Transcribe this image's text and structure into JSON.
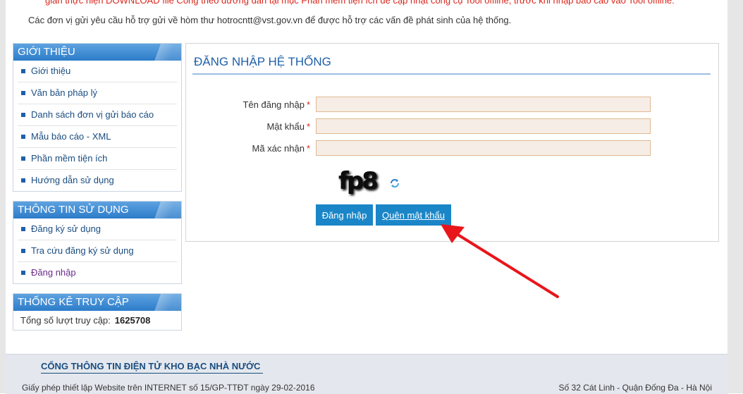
{
  "notice": {
    "top_text": "gian thực hiện DOWNLOAD file Công theo đường dẫn tại mục Phần mềm tiện ích để cập nhật công cụ Tool offline, trước khi nhập báo cáo vào Tool offline.",
    "support_text": "Các đơn vị gửi yêu cầu hỗ trợ gửi về hòm thư hotrocntt@vst.gov.vn để được hỗ trợ các vấn đề phát sinh của hệ thống."
  },
  "sidebar": {
    "intro": {
      "title": "GIỚI THIỆU",
      "items": [
        {
          "label": "Giới thiệu"
        },
        {
          "label": "Văn bản pháp lý"
        },
        {
          "label": "Danh sách đơn vị gửi báo cáo"
        },
        {
          "label": "Mẫu báo cáo - XML"
        },
        {
          "label": "Phần mềm tiện ích"
        },
        {
          "label": "Hướng dẫn sử dụng"
        }
      ]
    },
    "usage": {
      "title": "THÔNG TIN SỬ DỤNG",
      "items": [
        {
          "label": "Đăng ký sử dụng"
        },
        {
          "label": "Tra cứu đăng ký sử dụng"
        },
        {
          "label": "Đăng nhập"
        }
      ]
    },
    "stats": {
      "title": "THỐNG KÊ TRUY CẬP",
      "label": "Tổng số lượt truy cập:",
      "value": "1625708"
    }
  },
  "login": {
    "title": "ĐĂNG NHẬP HỆ THỐNG",
    "username_label": "Tên đăng nhập",
    "password_label": "Mật khẩu",
    "captcha_label": "Mã xác nhận",
    "required_mark": "*",
    "username_value": "",
    "password_value": "",
    "captcha_value": "",
    "captcha_text": "fp8",
    "login_button": "Đăng nhập",
    "forgot_button": "Quên mật khẩu"
  },
  "footer": {
    "title": "CỔNG THÔNG TIN ĐIỆN TỬ KHO BẠC NHÀ NƯỚC",
    "license": "Giấy phép thiết lập Website trên INTERNET số 15/GP-TTĐT ngày 29-02-2016",
    "address": "Số 32 Cát Linh - Quận Đống Đa - Hà Nội"
  },
  "colors": {
    "accent_blue": "#1a86c8",
    "header_blue": "#2c7cc9",
    "title_blue": "#1f5fa8",
    "notice_red": "#d9261c",
    "annotation_arrow": "#e8161b"
  },
  "icons": {
    "refresh": "refresh-icon",
    "bullet": "square-bullet-icon"
  }
}
